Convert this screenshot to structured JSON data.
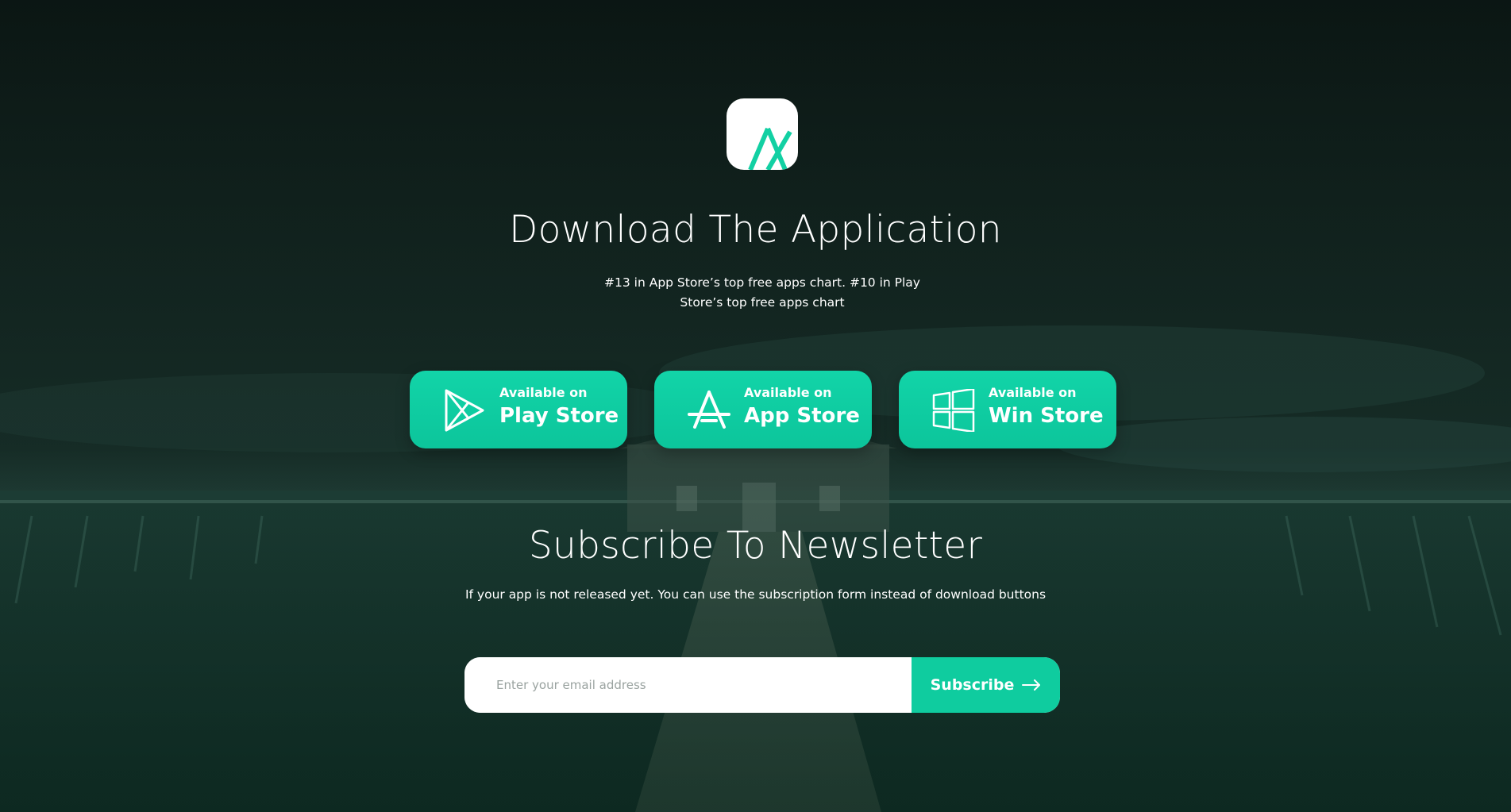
{
  "page": {
    "colors": {
      "accent": "#0fcc9f",
      "background": "#13231e",
      "text": "#ffffff"
    }
  },
  "download": {
    "logo_icon": "app-logo-icon",
    "title": "Download The Application",
    "subtitle": "#13 in App Store’s top free apps chart. #10 in Play Store’s top free apps chart"
  },
  "stores": [
    {
      "icon": "play-store-icon",
      "small_label": "Available on",
      "big_label": "Play Store"
    },
    {
      "icon": "app-store-icon",
      "small_label": "Available on",
      "big_label": "App Store"
    },
    {
      "icon": "windows-store-icon",
      "small_label": "Available on",
      "big_label": "Win Store"
    }
  ],
  "newsletter": {
    "title": "Subscribe To Newsletter",
    "note": "If your app is not released yet. You can use the subscription form instead of download buttons",
    "email_placeholder": "Enter your email address",
    "email_value": "",
    "subscribe_label": "Subscribe",
    "subscribe_icon": "arrow-right-icon"
  }
}
